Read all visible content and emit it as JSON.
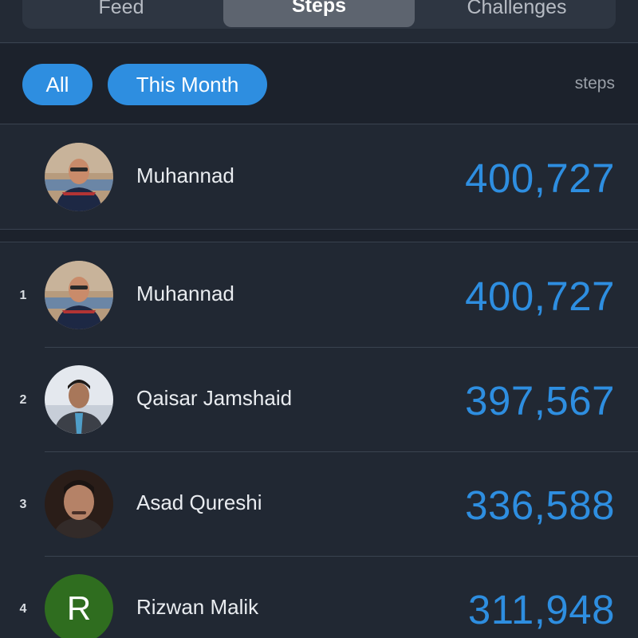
{
  "tabs": [
    {
      "label": "Feed"
    },
    {
      "label": "Steps"
    },
    {
      "label": "Challenges"
    }
  ],
  "filters": {
    "all_label": "All",
    "month_label": "This Month",
    "unit_label": "steps"
  },
  "current_user": {
    "name": "Muhannad",
    "steps": "400,727"
  },
  "leaderboard": [
    {
      "rank": "1",
      "name": "Muhannad",
      "steps": "400,727"
    },
    {
      "rank": "2",
      "name": "Qaisar Jamshaid",
      "steps": "397,567"
    },
    {
      "rank": "3",
      "name": "Asad Qureshi",
      "steps": "336,588"
    },
    {
      "rank": "4",
      "name": "Rizwan Malik",
      "steps": "311,948",
      "initial": "R"
    }
  ],
  "colors": {
    "accent": "#2e8ee0",
    "background": "#1f2631",
    "initial_avatar": "#2f6d1f"
  }
}
